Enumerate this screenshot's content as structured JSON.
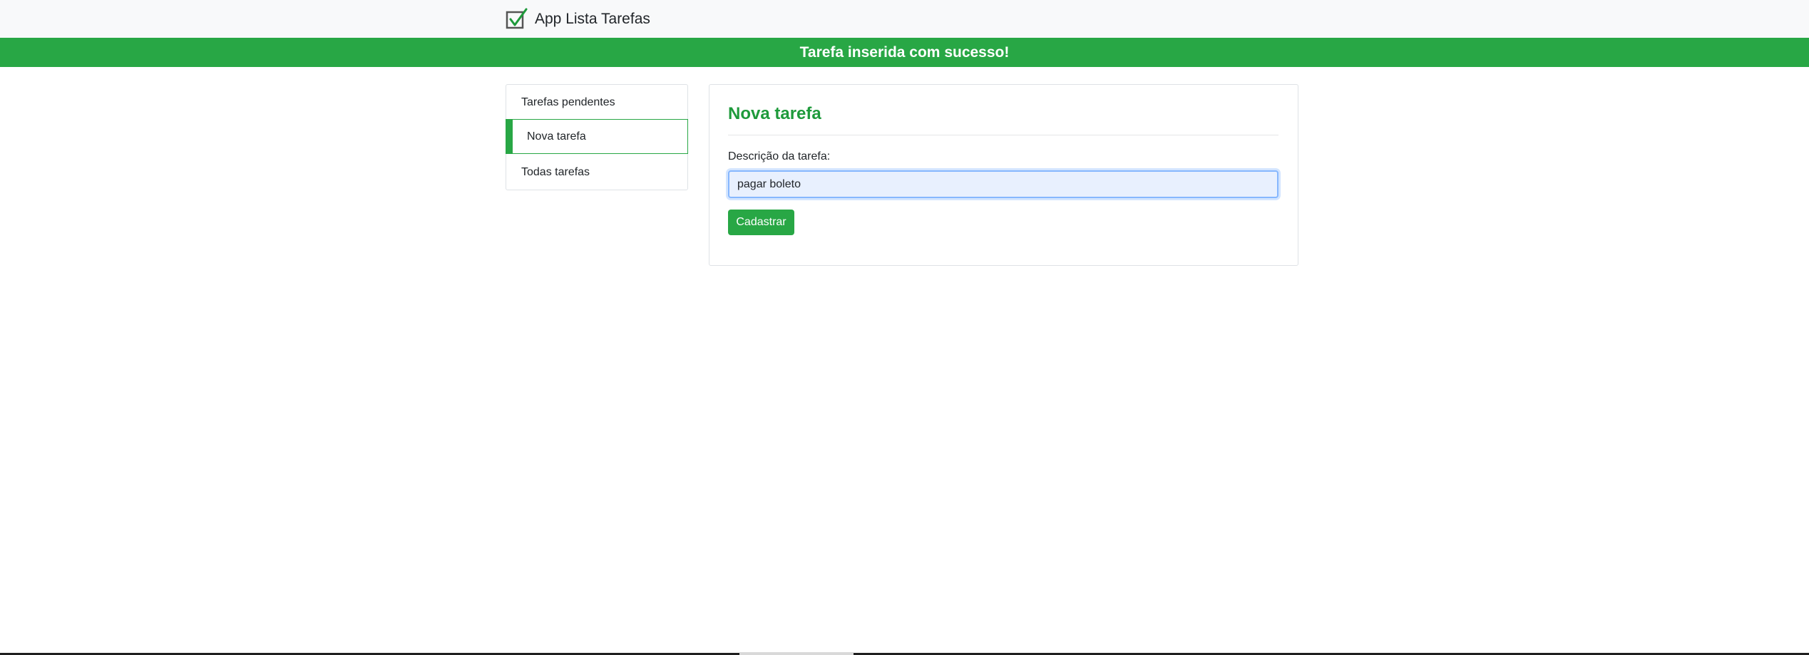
{
  "app": {
    "title": "App Lista Tarefas",
    "logo_icon": "checkbox-checked-icon"
  },
  "alert": {
    "message": "Tarefa inserida com sucesso!",
    "color": "#28a745"
  },
  "menu": {
    "items": [
      {
        "label": "Tarefas pendentes",
        "active": false
      },
      {
        "label": "Nova tarefa",
        "active": true
      },
      {
        "label": "Todas tarefas",
        "active": false
      }
    ]
  },
  "form": {
    "title": "Nova tarefa",
    "label": "Descrição da tarefa:",
    "input_value": "pagar boleto",
    "submit_label": "Cadastrar"
  },
  "colors": {
    "accent": "#28a745",
    "title": "#1e9a3b"
  }
}
